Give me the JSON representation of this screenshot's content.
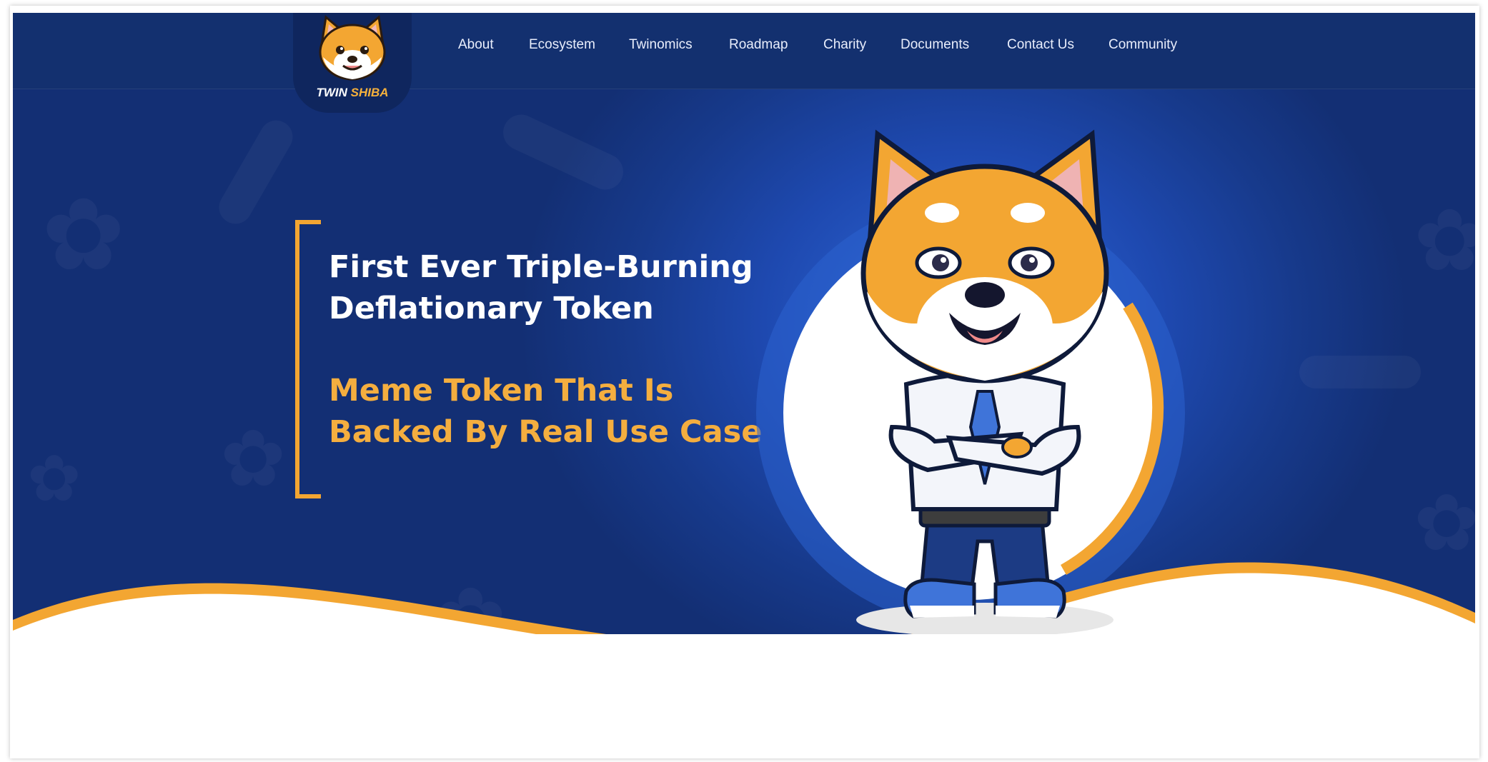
{
  "brand": {
    "name_part1": "TWIN",
    "name_part2": "SHIBA"
  },
  "nav": {
    "items": [
      {
        "label": "About"
      },
      {
        "label": "Ecosystem"
      },
      {
        "label": "Twinomics"
      },
      {
        "label": "Roadmap"
      },
      {
        "label": "Charity"
      },
      {
        "label": "Documents"
      },
      {
        "label": "Contact Us"
      },
      {
        "label": "Community"
      }
    ]
  },
  "hero": {
    "headline_line1": "First Ever Triple-Burning",
    "headline_line2": "Deflationary Token",
    "subhead_line1": "Meme Token That Is",
    "subhead_line2": "Backed By Real Use Case"
  },
  "colors": {
    "navy": "#13306f",
    "hero_blue": "#1e49b0",
    "accent_orange": "#f3a632",
    "subhead_orange": "#f4ae3f"
  },
  "icons": {
    "logo": "shiba-face-logo",
    "mascot": "shiba-mascot-arms-crossed",
    "decor": "paw-print-icon",
    "scroll": "scroll-button"
  }
}
